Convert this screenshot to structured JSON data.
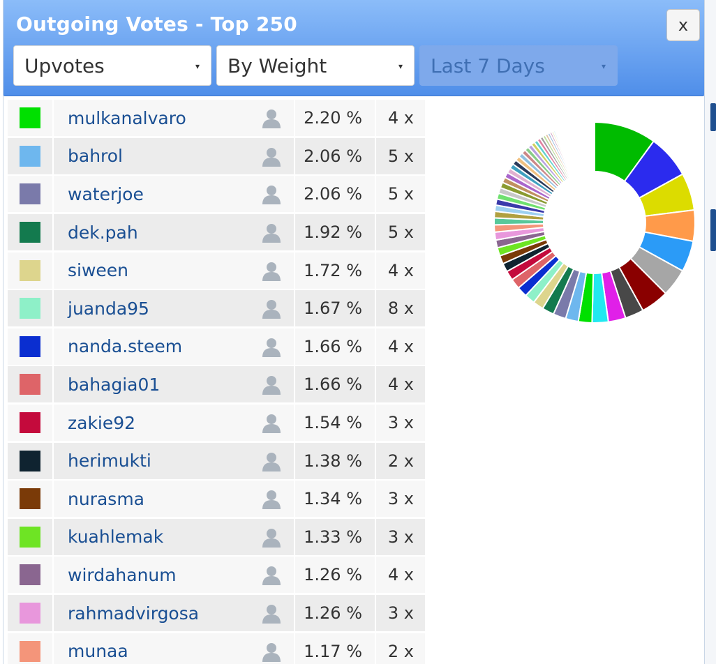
{
  "header": {
    "title": "Outgoing Votes - Top 250",
    "close_label": "x",
    "select_type": "Upvotes",
    "select_sort": "By Weight",
    "select_period": "Last 7 Days",
    "caret": "▾"
  },
  "table": {
    "rows": [
      {
        "color": "#00e000",
        "name": "mulkanalvaro",
        "pct": "2.20 %",
        "count": "4 x"
      },
      {
        "color": "#6eb7ee",
        "name": "bahrol",
        "pct": "2.06 %",
        "count": "5 x"
      },
      {
        "color": "#7a7aaa",
        "name": "waterjoe",
        "pct": "2.06 %",
        "count": "5 x"
      },
      {
        "color": "#137a4e",
        "name": "dek.pah",
        "pct": "1.92 %",
        "count": "5 x"
      },
      {
        "color": "#ddd58d",
        "name": "siween",
        "pct": "1.72 %",
        "count": "4 x"
      },
      {
        "color": "#8ef0c8",
        "name": "juanda95",
        "pct": "1.67 %",
        "count": "8 x"
      },
      {
        "color": "#0a2ed0",
        "name": "nanda.steem",
        "pct": "1.66 %",
        "count": "4 x"
      },
      {
        "color": "#de6468",
        "name": "bahagia01",
        "pct": "1.66 %",
        "count": "4 x"
      },
      {
        "color": "#c40a3c",
        "name": "zakie92",
        "pct": "1.54 %",
        "count": "3 x"
      },
      {
        "color": "#0f2330",
        "name": "herimukti",
        "pct": "1.38 %",
        "count": "2 x"
      },
      {
        "color": "#7a3a08",
        "name": "nurasma",
        "pct": "1.34 %",
        "count": "3 x"
      },
      {
        "color": "#6ee424",
        "name": "kuahlemak",
        "pct": "1.33 %",
        "count": "3 x"
      },
      {
        "color": "#8a6690",
        "name": "wirdahanum",
        "pct": "1.26 %",
        "count": "4 x"
      },
      {
        "color": "#e897dc",
        "name": "rahmadvirgosa",
        "pct": "1.26 %",
        "count": "3 x"
      },
      {
        "color": "#f4957a",
        "name": "munaa",
        "pct": "1.17 %",
        "count": "2 x"
      }
    ]
  },
  "chart_data": {
    "type": "pie",
    "donut": true,
    "slices": [
      {
        "color": "#00bb00",
        "value": 10.0
      },
      {
        "color": "#2b2bee",
        "value": 7.0
      },
      {
        "color": "#dcdc00",
        "value": 6.0
      },
      {
        "color": "#ff9a4a",
        "value": 5.0
      },
      {
        "color": "#2b9bf7",
        "value": 5.0
      },
      {
        "color": "#a6a6a6",
        "value": 4.5
      },
      {
        "color": "#8a0000",
        "value": 4.5
      },
      {
        "color": "#484848",
        "value": 3.0
      },
      {
        "color": "#e020e8",
        "value": 2.8
      },
      {
        "color": "#22e8f0",
        "value": 2.6
      },
      {
        "color": "#00e000",
        "value": 2.2
      },
      {
        "color": "#6eb7ee",
        "value": 2.06
      },
      {
        "color": "#7a7aaa",
        "value": 2.06
      },
      {
        "color": "#137a4e",
        "value": 1.92
      },
      {
        "color": "#ddd58d",
        "value": 1.72
      },
      {
        "color": "#8ef0c8",
        "value": 1.67
      },
      {
        "color": "#0a2ed0",
        "value": 1.66
      },
      {
        "color": "#de6468",
        "value": 1.66
      },
      {
        "color": "#c40a3c",
        "value": 1.54
      },
      {
        "color": "#0f2330",
        "value": 1.38
      },
      {
        "color": "#7a3a08",
        "value": 1.34
      },
      {
        "color": "#6ee424",
        "value": 1.33
      },
      {
        "color": "#8a6690",
        "value": 1.26
      },
      {
        "color": "#e897dc",
        "value": 1.26
      },
      {
        "color": "#f4957a",
        "value": 1.17
      },
      {
        "color": "#58c89a",
        "value": 1.1
      },
      {
        "color": "#b0a040",
        "value": 1.05
      },
      {
        "color": "#9dd0f0",
        "value": 1.0
      },
      {
        "color": "#3a3aaa",
        "value": 0.98
      },
      {
        "color": "#70e070",
        "value": 0.95
      },
      {
        "color": "#c8c8c8",
        "value": 0.93
      },
      {
        "color": "#8a9a30",
        "value": 0.9
      },
      {
        "color": "#c09060",
        "value": 0.88
      },
      {
        "color": "#aa66cc",
        "value": 0.85
      },
      {
        "color": "#e0b0d0",
        "value": 0.82
      },
      {
        "color": "#40a0c0",
        "value": 0.8
      },
      {
        "color": "#2a3a5a",
        "value": 0.78
      },
      {
        "color": "#f0c080",
        "value": 0.75
      },
      {
        "color": "#90c0e0",
        "value": 0.72
      },
      {
        "color": "#cc8888",
        "value": 0.7
      },
      {
        "color": "#88cc88",
        "value": 0.67
      },
      {
        "color": "#b8a0e0",
        "value": 0.64
      },
      {
        "color": "#d0d060",
        "value": 0.6
      },
      {
        "color": "#60d0d0",
        "value": 0.57
      },
      {
        "color": "#e080a0",
        "value": 0.54
      },
      {
        "color": "#a0a0a0",
        "value": 0.5
      },
      {
        "color": "#c0e0a0",
        "value": 0.46
      },
      {
        "color": "#e0c0a0",
        "value": 0.42
      },
      {
        "color": "#a0c0e0",
        "value": 0.38
      },
      {
        "color": "#d0a0c0",
        "value": 0.34
      },
      {
        "color": "#e8e8b0",
        "value": 0.3
      },
      {
        "color": "#b0e8e8",
        "value": 0.26
      }
    ]
  }
}
